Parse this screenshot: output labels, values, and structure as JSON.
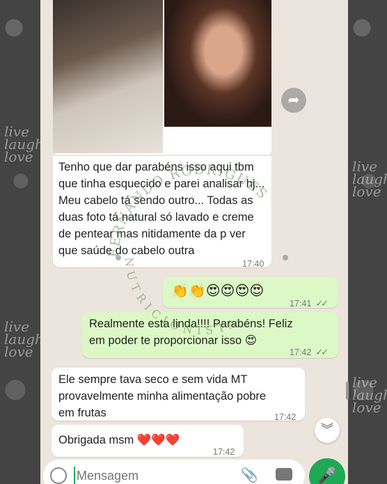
{
  "messages": [
    {
      "id": "m1",
      "direction": "incoming",
      "text": "Tenho que dar parabéns isso aqui tbm que tinha esquecido e parei analisar hj... Meu cabelo tá sendo outro... Todas as duas foto tá natural só lavado e creme de pentear mas nitidamente da p ver que saúde do cabelo outra",
      "time": "17:40"
    },
    {
      "id": "m2",
      "direction": "outgoing",
      "text": "👏👏😍😍😍😍",
      "time": "17:41",
      "status": "read"
    },
    {
      "id": "m3",
      "direction": "outgoing",
      "text": "Realmente esta linda!!!! Parabéns! Feliz em poder te proporcionar isso 😍",
      "time": "17:42",
      "status": "read"
    },
    {
      "id": "m4",
      "direction": "incoming",
      "text": "Ele sempre tava seco e sem vida MT provavelmente minha alimentação pobre em frutas",
      "time": "17:42"
    },
    {
      "id": "m5",
      "direction": "incoming",
      "text": "Obrigada msm ❤️❤️❤️",
      "time": "17:42"
    }
  ],
  "composer": {
    "placeholder": "Mensagem"
  },
  "icons": {
    "forward": "forward-icon",
    "scroll": "double-chevron-down-icon",
    "emoji": "emoji-icon",
    "attach": "paperclip-icon",
    "camera": "camera-icon",
    "mic": "mic-icon"
  },
  "watermark": {
    "top_text": "FERNANDO RODRIGUES",
    "bottom_text": "NUTRICIONISTA"
  },
  "colors": {
    "outgoing_bubble": "#dcf8c6",
    "incoming_bubble": "#ffffff",
    "chat_bg": "#ece5dd",
    "send_button": "#1fa855"
  }
}
